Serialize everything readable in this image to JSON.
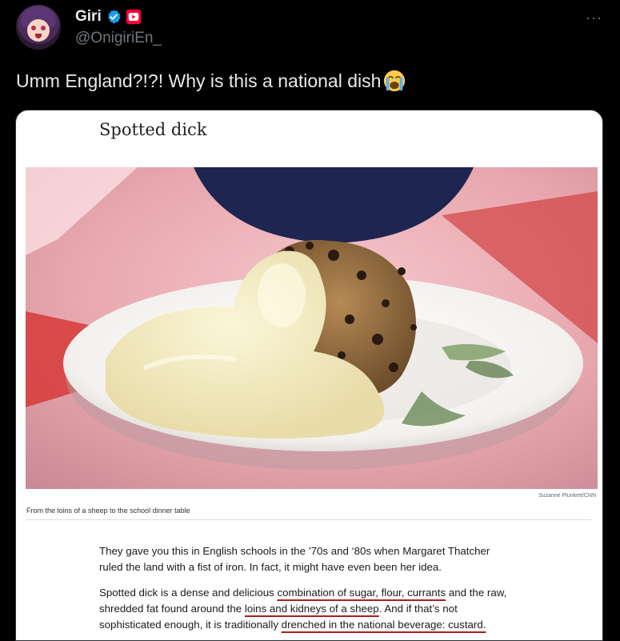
{
  "author": {
    "name": "Giri",
    "handle": "@OnigiriEn_"
  },
  "menu": {
    "more_label": "···"
  },
  "tweet": {
    "text": "Umm England?!?! Why is this a national dish",
    "emoji": "loudly-crying-face"
  },
  "card": {
    "title": "Spotted dick",
    "photo_credit": "Suzanne Plunkett/CNN",
    "caption": "From the loins of a sheep to the school dinner table",
    "paragraph1": "They gave you this in English schools in the ’70s and ‘80s when Margaret Thatcher ruled the land with a fist of iron. In fact, it might have even been her idea.",
    "p2_part1": "Spotted dick is a dense and delicious ",
    "p2_ul1": "combination of sugar, flour, currants",
    "p2_part2": " and the raw, shredded fat found around the ",
    "p2_ul2": "loins and kidneys of a sheep",
    "p2_part3": ". And if that’s not sophisticated enough, it is traditionally ",
    "p2_ul3": "drenched in the national beverage: custard."
  },
  "colors": {
    "background": "#000000",
    "verified_blue": "#1d9bf0",
    "youtube_red": "#ff0033",
    "underline_red": "#b01c1c"
  }
}
